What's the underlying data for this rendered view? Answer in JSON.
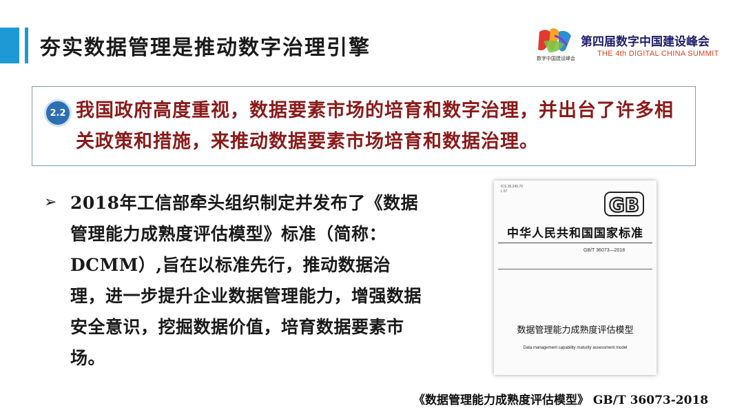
{
  "header": {
    "title": "夯实数据管理是推动数字治理引擎",
    "accent_color": "#1d9ad6"
  },
  "logo": {
    "mark_icon": "colorful-shu-character-logo",
    "mark_text": "数字中国建设峰会",
    "title_cn": "第四届数字中国建设峰会",
    "title_en": "THE 4th DIGITAL CHINA SUMMIT"
  },
  "highlight": {
    "badge": "2.2",
    "text": "我国政府高度重视，数据要素市场的培育和数字治理，并出台了许多相关政策和措施，来推动数据要素市场培育和数据治理。",
    "text_color": "#8b1a1a"
  },
  "bullet": {
    "arrow": "➢",
    "text": "2018年工信部牵头组织制定并发布了《数据管理能力成熟度评估模型》标准（简称：DCMM）,旨在以标准先行，推动数据治理，进一步提升企业数据管理能力，增强数据安全意识，挖掘数据价值，培育数据要素市场。"
  },
  "document_cover": {
    "ics": "ICS 35.240.70",
    "ccs": "L 67",
    "gb_logo_text": "GB",
    "country_standard": "中华人民共和国国家标准",
    "code": "GB/T 36073—2018",
    "title_cn": "数据管理能力成熟度评估模型",
    "title_en": "Data management capability maturity assessment model"
  },
  "caption": "《数据管理能力成熟度评估模型》 GB/T 36073-2018"
}
